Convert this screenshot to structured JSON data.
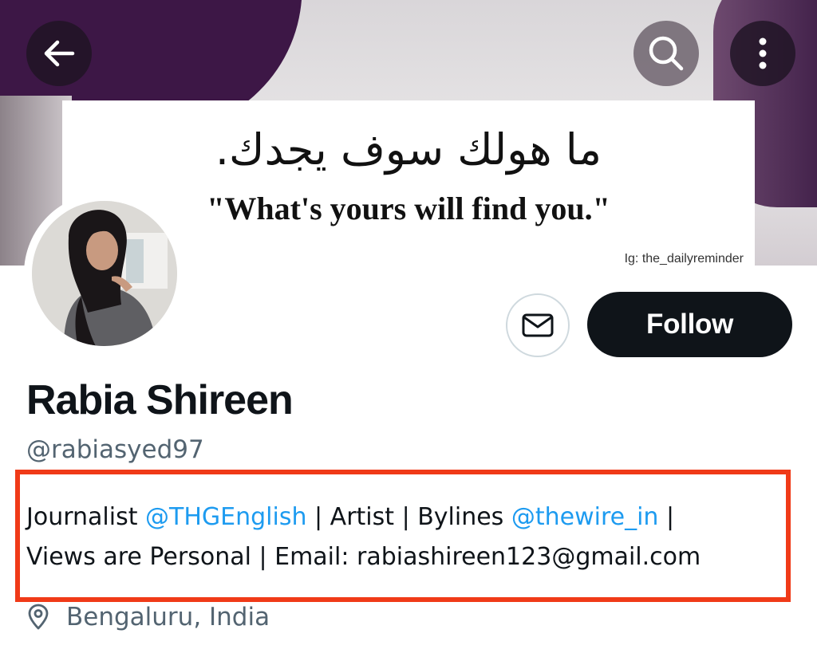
{
  "banner": {
    "arabic_text": "ما هولك سوف يجدك.",
    "english_quote": "\"What's yours will find you.\"",
    "credit": "Ig: the_dailyreminder"
  },
  "header": {
    "back_icon": "arrow-left-icon",
    "search_icon": "search-icon",
    "more_icon": "more-vertical-icon"
  },
  "actions": {
    "message_icon": "envelope-icon",
    "follow_label": "Follow"
  },
  "profile": {
    "display_name": "Rabia Shireen",
    "handle": "@rabiasyed97",
    "bio": {
      "line1_part1": "Journalist ",
      "mention1": "@THGEnglish",
      "line1_part2": " | Artist | Bylines ",
      "mention2": "@thewire_in",
      "line1_part3": " |",
      "line2": "Views are Personal | Email: rabiashireen123@gmail.com"
    },
    "location": "Bengaluru, India",
    "location_icon": "location-pin-icon"
  },
  "colors": {
    "accent": "#1d9bf0",
    "text_primary": "#0f1419",
    "text_secondary": "#536471",
    "highlight_border": "#f03a18",
    "follow_button_bg": "#0f1419"
  }
}
